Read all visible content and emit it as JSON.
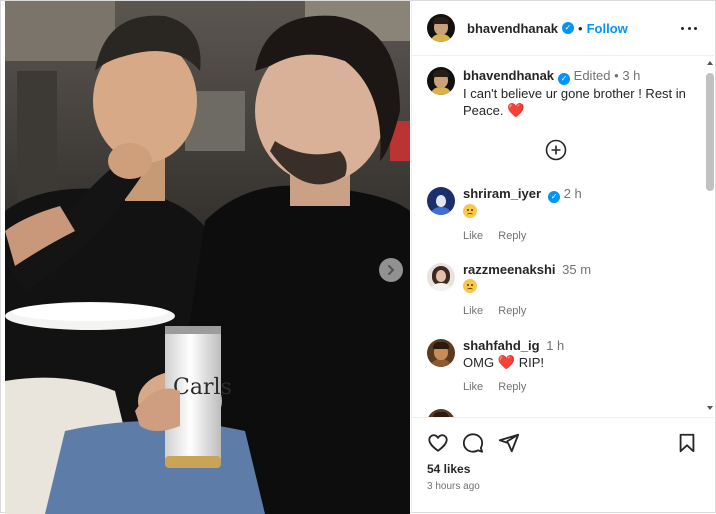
{
  "post": {
    "author": "bhavendhanak",
    "follow_label": "Follow",
    "separator": "•",
    "likes": "54 likes",
    "posted_ago": "3 hours ago"
  },
  "caption": {
    "username": "bhavendhanak",
    "edited": "Edited",
    "dot": "•",
    "time": "3 h",
    "text": "I can't believe ur gone brother ! Rest in Peace.",
    "emoji": "❤️"
  },
  "comments": [
    {
      "username": "shriram_iyer",
      "verified": true,
      "time": "2 h",
      "text": "",
      "emoji": "sad-face",
      "like_label": "Like",
      "reply_label": "Reply"
    },
    {
      "username": "razzmeenakshi",
      "verified": false,
      "time": "35 m",
      "text": "",
      "emoji": "sad-face",
      "like_label": "Like",
      "reply_label": "Reply"
    },
    {
      "username": "shahfahd_ig",
      "verified": false,
      "time": "1 h",
      "text_before": "OMG",
      "text_after": "RIP!",
      "heart": "❤️",
      "like_label": "Like",
      "reply_label": "Reply"
    }
  ],
  "icons": {
    "verified": "verified-badge-icon",
    "more": "more-options-icon",
    "load_more": "add-circle-icon",
    "next": "chevron-right-icon",
    "like": "heart-outline-icon",
    "comment": "comment-bubble-icon",
    "share": "paper-plane-icon",
    "save": "bookmark-icon"
  },
  "colors": {
    "accent": "#0095f6",
    "heart": "#ed4956",
    "muted": "#737373"
  }
}
